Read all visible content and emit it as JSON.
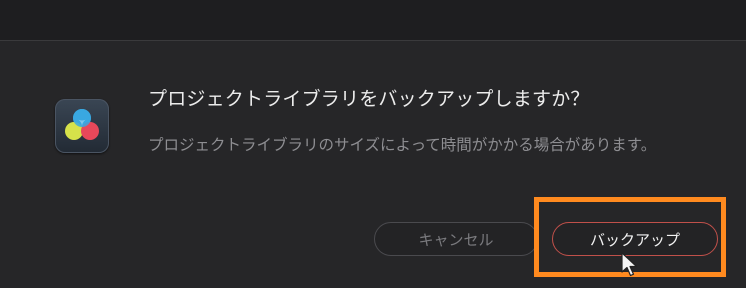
{
  "dialog": {
    "title": "プロジェクトライブラリをバックアップしますか？",
    "message": "プロジェクトライブラリのサイズによって時間がかかる場合があります。",
    "cancel_label": "キャンセル",
    "confirm_label": "バックアップ"
  },
  "icons": {
    "app": "davinci-resolve-app-icon",
    "cursor": "mouse-pointer-icon"
  },
  "colors": {
    "background": "#262628",
    "highlight": "#ff8a1f",
    "confirm_border": "#c0504a"
  }
}
